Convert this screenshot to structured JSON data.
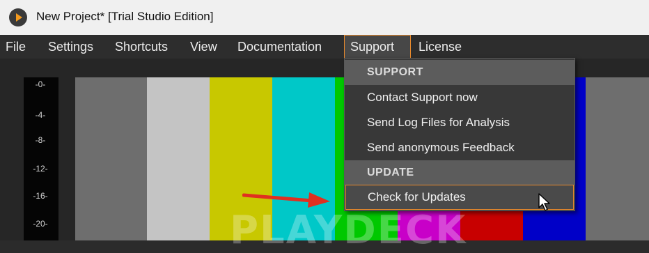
{
  "window": {
    "title": "New Project* [Trial Studio Edition]",
    "logo_icon": "playdeck-logo-icon"
  },
  "menubar": {
    "items": [
      {
        "label": "File"
      },
      {
        "label": "Settings"
      },
      {
        "label": "Shortcuts"
      },
      {
        "label": "View"
      },
      {
        "label": "Documentation"
      },
      {
        "label": "Support",
        "active": true
      },
      {
        "label": "License"
      }
    ]
  },
  "support_menu": {
    "support_header": "SUPPORT",
    "contact": "Contact Support now",
    "send_logs": "Send Log Files for Analysis",
    "feedback": "Send anonymous Feedback",
    "update_header": "UPDATE",
    "check_updates": "Check for Updates"
  },
  "audio_meter": {
    "labels": [
      "-0-",
      "-4-",
      "-8-",
      "-12-",
      "-16-",
      "-20-"
    ]
  },
  "preview": {
    "watermark": "PLAYDECK",
    "color_bars": [
      "#6e6e6e",
      "#c4c4c4",
      "#c8c800",
      "#00c8c8",
      "#00c800",
      "#c800c8",
      "#c80000",
      "#0000c8",
      "#6e6e6e"
    ]
  },
  "colors": {
    "accent": "#e88a2d",
    "arrow": "#e03020"
  }
}
